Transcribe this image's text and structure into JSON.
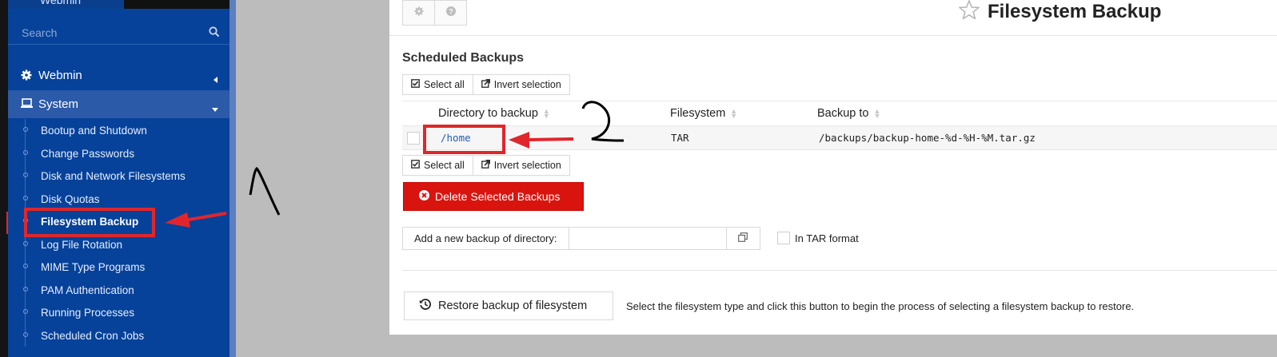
{
  "sidebar": {
    "brand": "Webmin",
    "search_placeholder": "Search",
    "sections": [
      {
        "label": "Webmin"
      },
      {
        "label": "System"
      }
    ],
    "items": [
      {
        "label": "Bootup and Shutdown"
      },
      {
        "label": "Change Passwords"
      },
      {
        "label": "Disk and Network Filesystems"
      },
      {
        "label": "Disk Quotas"
      },
      {
        "label": "Filesystem Backup"
      },
      {
        "label": "Log File Rotation"
      },
      {
        "label": "MIME Type Programs"
      },
      {
        "label": "PAM Authentication"
      },
      {
        "label": "Running Processes"
      },
      {
        "label": "Scheduled Cron Jobs"
      }
    ],
    "active_item": "Filesystem Backup"
  },
  "page": {
    "title": "Filesystem Backup",
    "section_title": "Scheduled Backups",
    "select_all": "Select all",
    "invert_selection": "Invert selection",
    "table": {
      "headers": [
        "Directory to backup",
        "Filesystem",
        "Backup to"
      ],
      "rows": [
        {
          "directory": "/home",
          "filesystem": "TAR",
          "backup_to": "/backups/backup-home-%d-%H-%M.tar.gz"
        }
      ]
    },
    "delete_button": "Delete Selected Backups",
    "add_label": "Add a new backup of directory:",
    "add_value": "",
    "tar_format_label": "In TAR format",
    "restore_button": "Restore backup of filesystem",
    "restore_help": "Select the filesystem type and click this button to begin the process of selecting a filesystem backup to restore."
  },
  "colors": {
    "sidebar": "#06429a",
    "danger": "#d9140f",
    "annotation": "#e0262c"
  }
}
